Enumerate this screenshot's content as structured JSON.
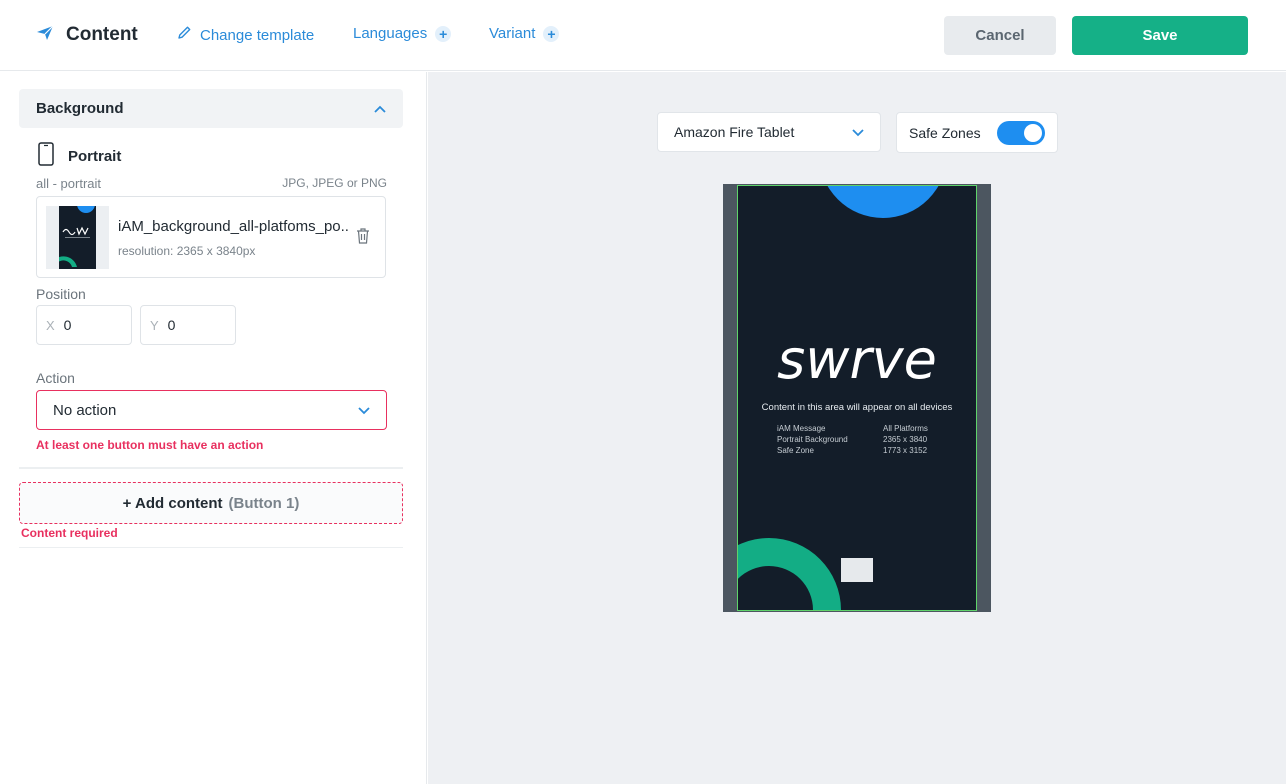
{
  "header": {
    "title": "Content",
    "change_template": "Change template",
    "languages": "Languages",
    "variant": "Variant",
    "plus": "+",
    "cancel": "Cancel",
    "save": "Save"
  },
  "left": {
    "section_title": "Background",
    "orientation": "Portrait",
    "sub_label": "all - portrait",
    "formats": "JPG, JPEG or PNG",
    "file": {
      "name": "iAM_background_all-platfoms_po...",
      "resolution": "resolution: 2365 x 3840px"
    },
    "position_label": "Position",
    "x_prefix": "X",
    "x_value": "0",
    "y_prefix": "Y",
    "y_value": "0",
    "action_label": "Action",
    "action_value": "No action",
    "action_error": "At least one button must have an action",
    "add_content": "+ Add content",
    "add_content_sub": "(Button 1)",
    "content_error": "Content required"
  },
  "right": {
    "device": "Amazon Fire Tablet",
    "safe_zones": "Safe Zones",
    "safe_zones_on": true,
    "preview": {
      "logo_text": "swrve",
      "area_text": "Content in this area will appear on all devices",
      "info_left": [
        "iAM Message",
        "Portrait Background",
        "Safe Zone"
      ],
      "info_right": [
        "All Platforms",
        "2365 x 3840",
        "1773 x 3152"
      ]
    }
  },
  "colors": {
    "accent": "#2b8bd9",
    "save": "#15b087",
    "error": "#e8305f",
    "toggle": "#1e8ef0",
    "preview_bg": "#131d29",
    "preview_blue": "#1e8ef0",
    "preview_green": "#13ad85"
  }
}
